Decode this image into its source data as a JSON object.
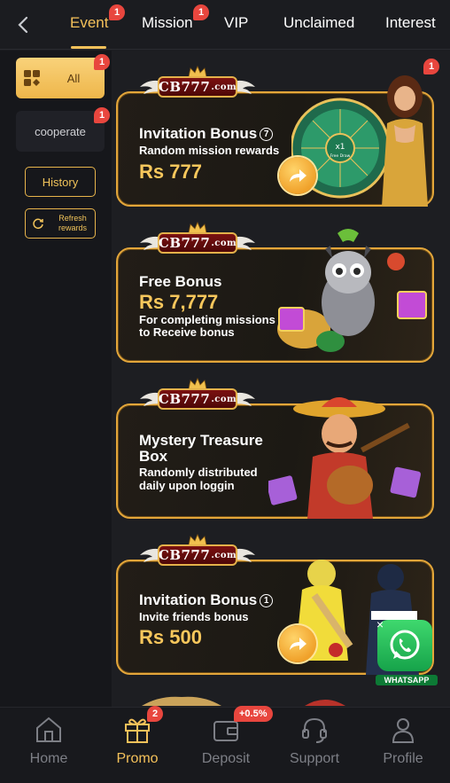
{
  "header": {
    "tabs": [
      {
        "label": "Event",
        "badge": "1",
        "active": true
      },
      {
        "label": "Mission",
        "badge": "1",
        "active": false
      },
      {
        "label": "VIP",
        "badge": "",
        "active": false
      },
      {
        "label": "Unclaimed",
        "badge": "",
        "active": false
      },
      {
        "label": "Interest",
        "badge": "",
        "active": false
      }
    ]
  },
  "sidebar": {
    "categories": [
      {
        "label": "All",
        "badge": "1",
        "active": true
      },
      {
        "label": "cooperate",
        "badge": "1",
        "active": false
      }
    ],
    "history_label": "History",
    "refresh_label_1": "Refresh",
    "refresh_label_2": "rewards"
  },
  "promo_badge": "1",
  "banners": [
    {
      "logo": "CB777",
      "logo_suffix": ".com",
      "title": "Invitation Bonus",
      "title_num": "7",
      "sub_1": "Random mission rewards",
      "sub_2": "",
      "amount": "Rs 777",
      "wheel_label": "x1",
      "wheel_sub": "Free Draw"
    },
    {
      "logo": "CB777",
      "logo_suffix": ".com",
      "title": "Free Bonus",
      "amount": "Rs 7,777",
      "sub_1": "For completing missions",
      "sub_2": "to Receive bonus"
    },
    {
      "logo": "CB777",
      "logo_suffix": ".com",
      "title": "Mystery Treasure",
      "title_2": "Box",
      "sub_1": "Randomly distributed",
      "sub_2": "daily upon loggin"
    },
    {
      "logo": "CB777",
      "logo_suffix": ".com",
      "title": "Invitation Bonus",
      "title_num": "1",
      "sub_1": "Invite friends bonus",
      "amount": "Rs 500"
    }
  ],
  "whatsapp": {
    "label": "WHATSAPP"
  },
  "bottom_nav": {
    "items": [
      {
        "label": "Home",
        "icon": "home-icon",
        "badge": ""
      },
      {
        "label": "Promo",
        "icon": "gift-icon",
        "badge": "2",
        "active": true
      },
      {
        "label": "Deposit",
        "icon": "wallet-icon",
        "badge": "+0.5%"
      },
      {
        "label": "Support",
        "icon": "headset-icon",
        "badge": ""
      },
      {
        "label": "Profile",
        "icon": "user-icon",
        "badge": ""
      }
    ]
  },
  "colors": {
    "accent": "#f4c15a",
    "badge": "#e8463e",
    "background": "#1d1e22"
  }
}
